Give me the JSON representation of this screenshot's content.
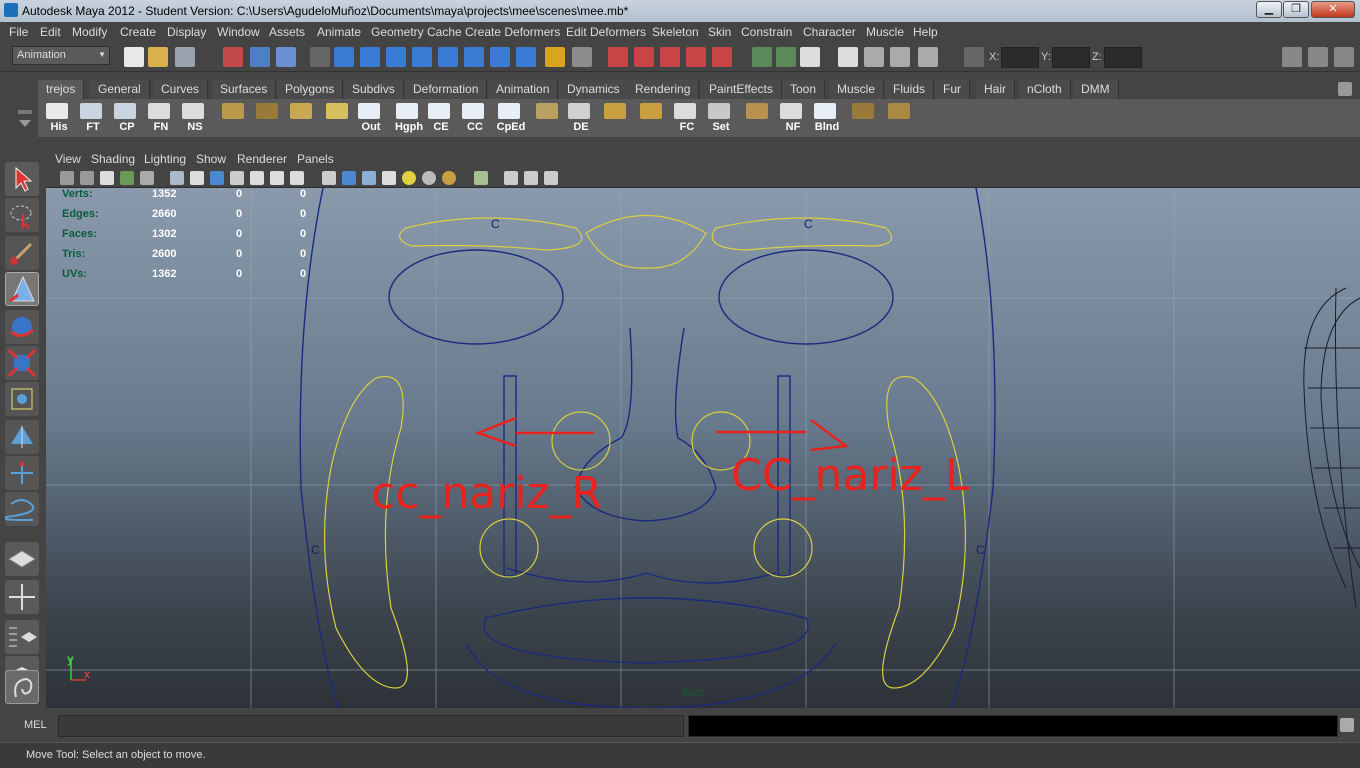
{
  "titlebar": {
    "title": "Autodesk Maya 2012 - Student Version: C:\\Users\\AgudeloMuñoz\\Documents\\maya\\projects\\mee\\scenes\\mee.mb*",
    "min": "▁",
    "max": "❐",
    "close": "✕"
  },
  "menu": [
    "File",
    "Edit",
    "Modify",
    "Create",
    "Display",
    "Window",
    "Assets",
    "Animate",
    "Geometry Cache",
    "Create Deformers",
    "Edit Deformers",
    "Skeleton",
    "Skin",
    "Constrain",
    "Character",
    "Muscle",
    "Help"
  ],
  "status": {
    "mode": "Animation",
    "x_label": "X:",
    "y_label": "Y:",
    "z_label": "Z:"
  },
  "shelf_tabs": [
    "trejos",
    "General",
    "Curves",
    "Surfaces",
    "Polygons",
    "Subdivs",
    "Deformation",
    "Animation",
    "Dynamics",
    "Rendering",
    "PaintEffects",
    "Toon",
    "Muscle",
    "Fluids",
    "Fur",
    "Hair",
    "nCloth",
    "DMM"
  ],
  "shelf_buttons": [
    "His",
    "FT",
    "CP",
    "FN",
    "NS",
    "",
    "",
    "",
    "Out",
    "Hgph",
    "CE",
    "CC",
    "CpEd",
    "",
    "DE",
    "",
    "",
    "FC",
    "Set",
    "",
    "NF",
    "Blnd",
    "",
    ""
  ],
  "panel_menu": [
    "View",
    "Shading",
    "Lighting",
    "Show",
    "Renderer",
    "Panels"
  ],
  "hud": {
    "rows": [
      {
        "label": "Verts:",
        "v1": "1352",
        "v2": "0",
        "v3": "0"
      },
      {
        "label": "Edges:",
        "v1": "2660",
        "v2": "0",
        "v3": "0"
      },
      {
        "label": "Faces:",
        "v1": "1302",
        "v2": "0",
        "v3": "0"
      },
      {
        "label": "Tris:",
        "v1": "2600",
        "v2": "0",
        "v3": "0"
      },
      {
        "label": "UVs:",
        "v1": "1362",
        "v2": "0",
        "v3": "0"
      }
    ]
  },
  "viewport": {
    "camera": "front",
    "annot_r": "cc_nariz_R",
    "annot_l": "CC_nariz_L",
    "ctrl_letter": "C",
    "axis_y": "y",
    "axis_x": "x"
  },
  "mel": {
    "label": "MEL"
  },
  "help": {
    "text": "Move Tool: Select an object to move."
  },
  "colors": {
    "annotation": "#e8231e",
    "curve_yellow": "#d8d040",
    "curve_blue": "#1b2a80"
  }
}
